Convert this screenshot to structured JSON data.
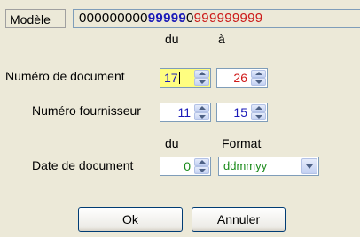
{
  "model": {
    "label": "Modèle",
    "segments": [
      "000000000",
      "99999",
      "0",
      "999999999"
    ]
  },
  "headers": {
    "du": "du",
    "a": "à",
    "du2": "du",
    "format": "Format"
  },
  "document_number": {
    "label": "Numéro de document",
    "from": "17",
    "to": "26"
  },
  "supplier_number": {
    "label": "Numéro fournisseur",
    "from": "11",
    "to": "15"
  },
  "document_date": {
    "label": "Date de document",
    "value": "0",
    "format": "ddmmyy"
  },
  "buttons": {
    "ok": "Ok",
    "cancel": "Annuler"
  },
  "colors": {
    "blue": "#1a1ab8",
    "red": "#d01a1a",
    "green": "#1a8a1a",
    "highlight": "#fffe80"
  }
}
